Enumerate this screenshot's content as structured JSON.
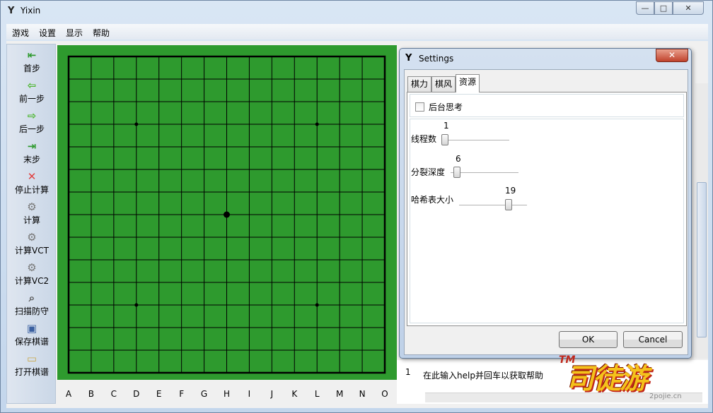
{
  "window": {
    "icon": "Y",
    "title": "Yixin",
    "minimize_glyph": "—",
    "maximize_glyph": "□",
    "close_glyph": "✕"
  },
  "menu": [
    "游戏",
    "设置",
    "显示",
    "帮助"
  ],
  "toolbar": [
    {
      "label": "首步",
      "icon": "first-step-icon",
      "glyph": "⇤",
      "color": "#2f9a2f"
    },
    {
      "label": "前一步",
      "icon": "previous-step-icon",
      "glyph": "⇦",
      "color": "#49b52b"
    },
    {
      "label": "后一步",
      "icon": "next-step-icon",
      "glyph": "⇨",
      "color": "#49b52b"
    },
    {
      "label": "末步",
      "icon": "last-step-icon",
      "glyph": "⇥",
      "color": "#2f9a2f"
    },
    {
      "label": "停止计算",
      "icon": "stop-icon",
      "glyph": "✕",
      "color": "#e04040"
    },
    {
      "label": "计算",
      "icon": "gear-icon",
      "glyph": "⚙",
      "color": "#777777"
    },
    {
      "label": "计算VCT",
      "icon": "gear-icon",
      "glyph": "⚙",
      "color": "#777777"
    },
    {
      "label": "计算VC2",
      "icon": "gear-icon",
      "glyph": "⚙",
      "color": "#777777"
    },
    {
      "label": "扫描防守",
      "icon": "magnifier-icon",
      "glyph": "⌕",
      "color": "#555555"
    },
    {
      "label": "保存棋谱",
      "icon": "save-icon",
      "glyph": "▣",
      "color": "#3a5fa0"
    },
    {
      "label": "打开棋谱",
      "icon": "open-folder-icon",
      "glyph": "▭",
      "color": "#c9a84a"
    }
  ],
  "board": {
    "size": 15,
    "color": "#2e9a2e",
    "line_color": "#000000",
    "columns": [
      "A",
      "B",
      "C",
      "D",
      "E",
      "F",
      "G",
      "H",
      "I",
      "J",
      "K",
      "L",
      "M",
      "N",
      "O"
    ],
    "star_points": [
      [
        "D",
        4
      ],
      [
        "L",
        4
      ],
      [
        "D",
        12
      ],
      [
        "L",
        12
      ]
    ],
    "center_point": [
      "H",
      8
    ]
  },
  "console": {
    "line_number": "1",
    "hint": "在此输入help并回车以获取帮助"
  },
  "settings": {
    "icon": "Y",
    "title": "Settings",
    "close_glyph": "✕",
    "tabs": [
      "棋力",
      "棋风",
      "资源"
    ],
    "active_tab": "资源",
    "background_thinking": {
      "label": "后台思考",
      "checked": false
    },
    "sliders": [
      {
        "label": "线程数",
        "value": "1",
        "level": 0.0
      },
      {
        "label": "分裂深度",
        "value": "6",
        "level": 0.05
      },
      {
        "label": "哈希表大小",
        "value": "19",
        "level": 0.75
      }
    ],
    "ok_label": "OK",
    "cancel_label": "Cancel"
  },
  "watermark": {
    "tm": "TM",
    "logo": "司徒游",
    "site": "2pojie.cn"
  }
}
